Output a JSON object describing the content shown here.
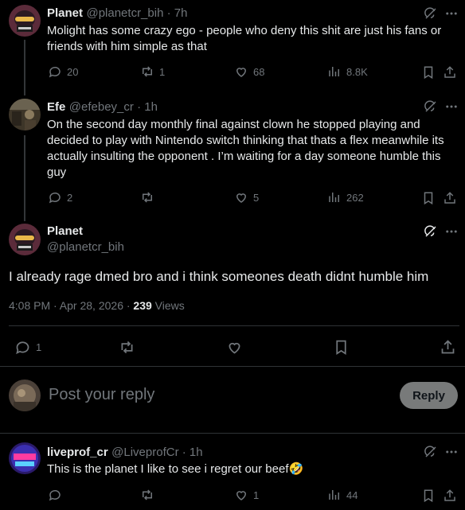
{
  "tweets": [
    {
      "name": "Planet",
      "handle": "@planetcr_bih",
      "time": "7h",
      "text": "Molight has some crazy ego - people who deny this shit are just his fans or friends with him simple as that",
      "replies": "20",
      "retweets": "1",
      "likes": "68",
      "views": "8.8K"
    },
    {
      "name": "Efe",
      "handle": "@efebey_cr",
      "time": "1h",
      "text": "On the second day monthly final against clown he stopped playing and decided to play with Nintendo switch thinking that thats a flex meanwhile its actually insulting the opponent . I’m waiting for a day someone humble this guy",
      "replies": "2",
      "retweets": "",
      "likes": "5",
      "views": "262"
    }
  ],
  "main": {
    "name": "Planet",
    "handle": "@planetcr_bih",
    "text": "I already rage dmed bro and i think someones death didnt humble him",
    "timestamp": "4:08 PM · Apr 28, 2026 · ",
    "views_count": "239",
    "views_label": " Views",
    "replies": "1"
  },
  "composer": {
    "placeholder": "Post your reply",
    "reply_button": "Reply"
  },
  "reply": {
    "name": "liveprof_cr",
    "handle": "@LiveprofCr",
    "time": "1h",
    "text": "This is the planet I like to see i regret our beef",
    "emoji": "🤣",
    "likes": "1",
    "views": "44"
  },
  "colors": {
    "background": "#000000",
    "text": "#e7e9ea",
    "muted": "#71767b",
    "divider": "#2f3336",
    "reply_button_bg": "#787a7a"
  },
  "icons": [
    "grok-icon",
    "more-icon",
    "reply-icon",
    "retweet-icon",
    "like-icon",
    "views-icon",
    "bookmark-icon",
    "share-icon"
  ]
}
